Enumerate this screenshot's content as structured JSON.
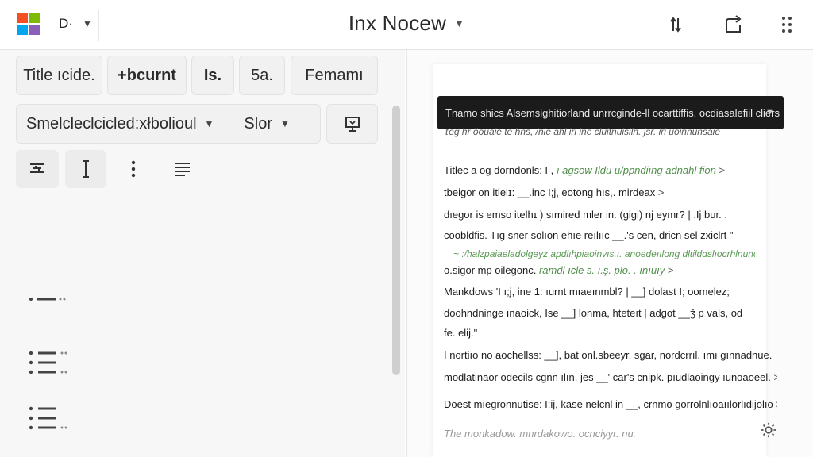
{
  "header": {
    "doc_switch_label": "D·",
    "title": "Inx Nocew",
    "icons": {
      "logo": "windows-logo-icon",
      "sort": "swap-vertical-icon",
      "share": "share-icon",
      "more": "more-vertical-icon"
    },
    "logo_colors": [
      "#f25022",
      "#7fba00",
      "#00a4ef",
      "#8a5fb8"
    ]
  },
  "toolbar": {
    "row1": [
      "Title ıcide.",
      "+bcurnt",
      "Is.",
      "5a.",
      "Femamı"
    ],
    "style_select": "Smelclеclcicled:xłbolioul",
    "size_select": "Slor",
    "icons_row3": [
      "align-center-icon",
      "text-cursor-icon",
      "more-vertical-icon",
      "align-left-icon"
    ]
  },
  "outline": {
    "icons": [
      "dash-list-icon",
      "bullet-list-icon",
      "bullet-list-icon"
    ]
  },
  "document": {
    "banner": "Tnamo shics Alsemsighitiorland unrrcginde-ll ocarttiffis, ocdiasalefiil cliers",
    "subbanner": "ťeg hr ŏouaie te hns, /nie ahl iri ine cluitnuisiln. jsr. iri uoinnunsaie",
    "lines": [
      {
        "text": "Titlec a og dorndonls: I ,",
        "green": "ı agsow Ildu u/ppndiıng adnahl fion",
        "chev": ">"
      },
      {
        "text": "tbeigor on itlelɪ: __.inc I;j, eotong hıs,. mirdeax",
        "green": "",
        "chev": ">"
      },
      {
        "text": "dıegor is emso itelhɪ ) sımired mler in. (gigi) nj eymr? | .Ij bur. .",
        "green": "",
        "chev": ""
      },
      {
        "text": "coobldfis. Tıg sner solıon ehıe reılııc __.'s cen, dricn sel zxiclrt \"",
        "green": "",
        "chev": ""
      },
      {
        "text": "o.sigor mp oilegonc.",
        "green": "ramdl ıcle s. ı.ş. plo. .  ınıuıy",
        "chev": ">"
      },
      {
        "text": "Mankdows 'I ı;j, ine 1: ıurnt mıaeınmbl? | __] dolast I; oomelez;",
        "green": "",
        "chev": ""
      },
      {
        "text": "doohndninge ınaoick, Ise __] lonma, hteteıt | adgot __ǯ p vals, od",
        "green": "",
        "chev": ""
      },
      {
        "text": "fe. elij.\"",
        "green": "",
        "chev": ""
      },
      {
        "text": "I nortiıo no aochellss: __], bat onl.sbeeyr. sgar, nordcrrıl. ımı gınnadnue.",
        "green": "",
        "chev": ""
      },
      {
        "text": "modlatinaor odecils cgnn ılın. jes __' car's cnipk. pıudlaoingy ıunoaoeel.",
        "green": "",
        "chev": ">"
      },
      {
        "text": "Doest mıegronnutise: I:ij, kase nelcnl in __, crnmo gorrolnlıoaıılorlıdijolıo",
        "green": "",
        "chev": ">"
      },
      {
        "text": "The monkadow. mnrdakowo. ocnciyyr. nu.",
        "green": "",
        "chev": ""
      }
    ],
    "squiggle": "~ :/halzpaiaeladolgeyz apdlıhpiaoinvıs.ı. anoedeıılong dltilddslıocrhlnunoea.",
    "settings_icon": "settings-gear-icon"
  }
}
